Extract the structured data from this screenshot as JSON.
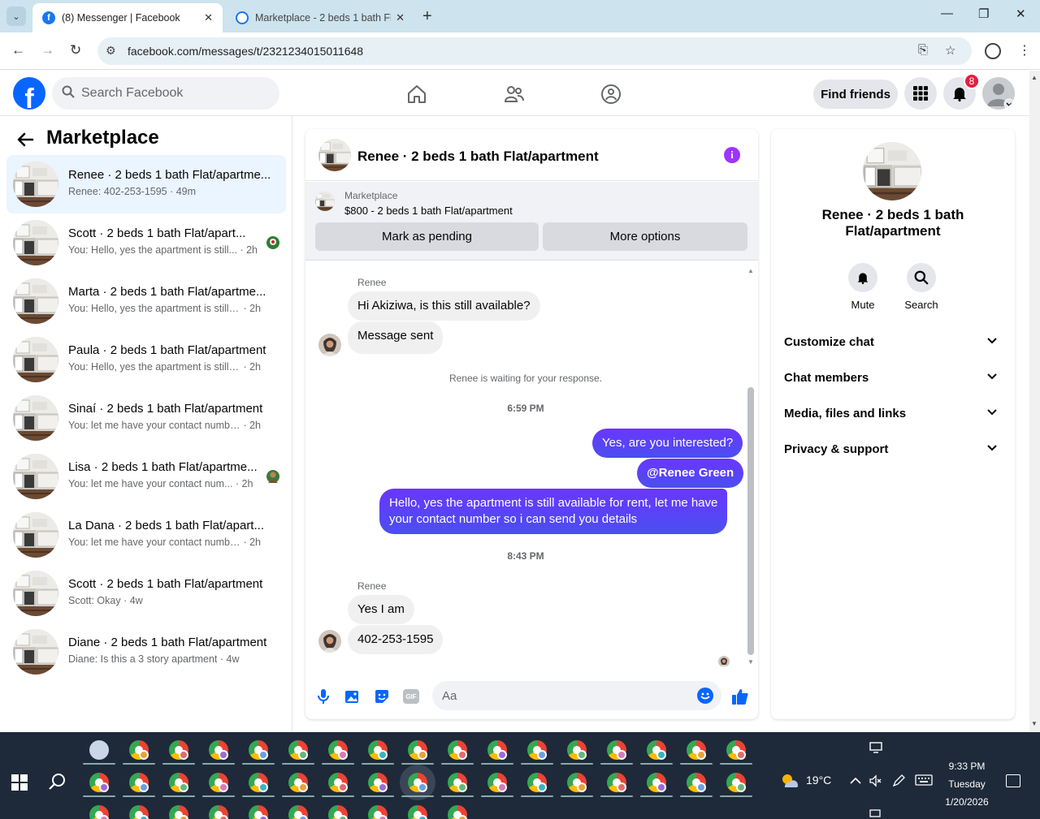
{
  "browser": {
    "tabs": [
      {
        "title": "(8) Messenger | Facebook",
        "active": true
      },
      {
        "title": "Marketplace - 2 beds 1 bath Fla",
        "active": false
      }
    ],
    "url": "facebook.com/messages/t/2321234015011648"
  },
  "fb_nav": {
    "search_placeholder": "Search Facebook",
    "find_friends": "Find friends",
    "notification_count": "8",
    "logo_letter": "f"
  },
  "left": {
    "title": "Marketplace",
    "conversations": [
      {
        "name": "Renee · 2 beds 1 bath Flat/apartme...",
        "snippet": "Renee: 402-253-1595",
        "time": "49m",
        "selected": true
      },
      {
        "name": "Scott · 2 beds 1 bath Flat/apart...",
        "snippet": "You: Hello, yes the apartment is still...",
        "time": "2h",
        "seen": true
      },
      {
        "name": "Marta · 2 beds 1 bath Flat/apartme...",
        "snippet": "You: Hello, yes the apartment is still a...",
        "time": "2h"
      },
      {
        "name": "Paula · 2 beds 1 bath Flat/apartment",
        "snippet": "You: Hello, yes the apartment is still a...",
        "time": "2h"
      },
      {
        "name": "Sinaí · 2 beds 1 bath Flat/apartment",
        "snippet": "You: let me have your contact number...",
        "time": "2h"
      },
      {
        "name": "Lisa · 2 beds 1 bath Flat/apartme...",
        "snippet": "You: let me have your contact num...",
        "time": "2h",
        "seen": true
      },
      {
        "name": "La Dana · 2 beds 1 bath Flat/apart...",
        "snippet": "You: let me have your contact number...",
        "time": "2h"
      },
      {
        "name": "Scott · 2 beds 1 bath Flat/apartment",
        "snippet": "Scott: Okay",
        "time": "4w"
      },
      {
        "name": "Diane · 2 beds 1 bath Flat/apartment",
        "snippet": "Diane: Is this a 3 story apartment",
        "time": "4w"
      }
    ]
  },
  "chat": {
    "title": "Renee · 2 beds 1 bath Flat/apartment",
    "banner_label": "Marketplace",
    "banner_listing": "$800 - 2 beds 1 bath Flat/apartment",
    "mark_pending": "Mark as pending",
    "more_options": "More options",
    "sender_1": "Renee",
    "msg_1": "Hi Akiziwa, is this still available?",
    "msg_2": "Message sent",
    "system": "Renee is waiting for your response.",
    "time_1": "6:59 PM",
    "out_1": "Yes, are you interested?",
    "out_2": "@Renee Green",
    "out_3_line1": "Hello, yes the apartment is still available for rent, let me have",
    "out_3_line2": "your contact number so i can send you details",
    "time_2": "8:43 PM",
    "sender_2": "Renee",
    "msg_3": "Yes I am",
    "msg_4": "402-253-1595",
    "composer_placeholder": "Aa",
    "gif_label": "GIF"
  },
  "right": {
    "name_line1": "Renee · 2 beds 1 bath",
    "name_line2": "Flat/apartment",
    "mute": "Mute",
    "search": "Search",
    "sections": [
      "Customize chat",
      "Chat members",
      "Media, files and links",
      "Privacy & support"
    ]
  },
  "taskbar": {
    "temperature": "19°C",
    "time": "9:33 PM",
    "day": "Tuesday",
    "date": "1/20/2026"
  },
  "colors": {
    "fb_blue": "#0866ff",
    "out_bubble": "#5b3fff",
    "selected_row": "#ebf5ff",
    "badge_red": "#e41e3f"
  }
}
